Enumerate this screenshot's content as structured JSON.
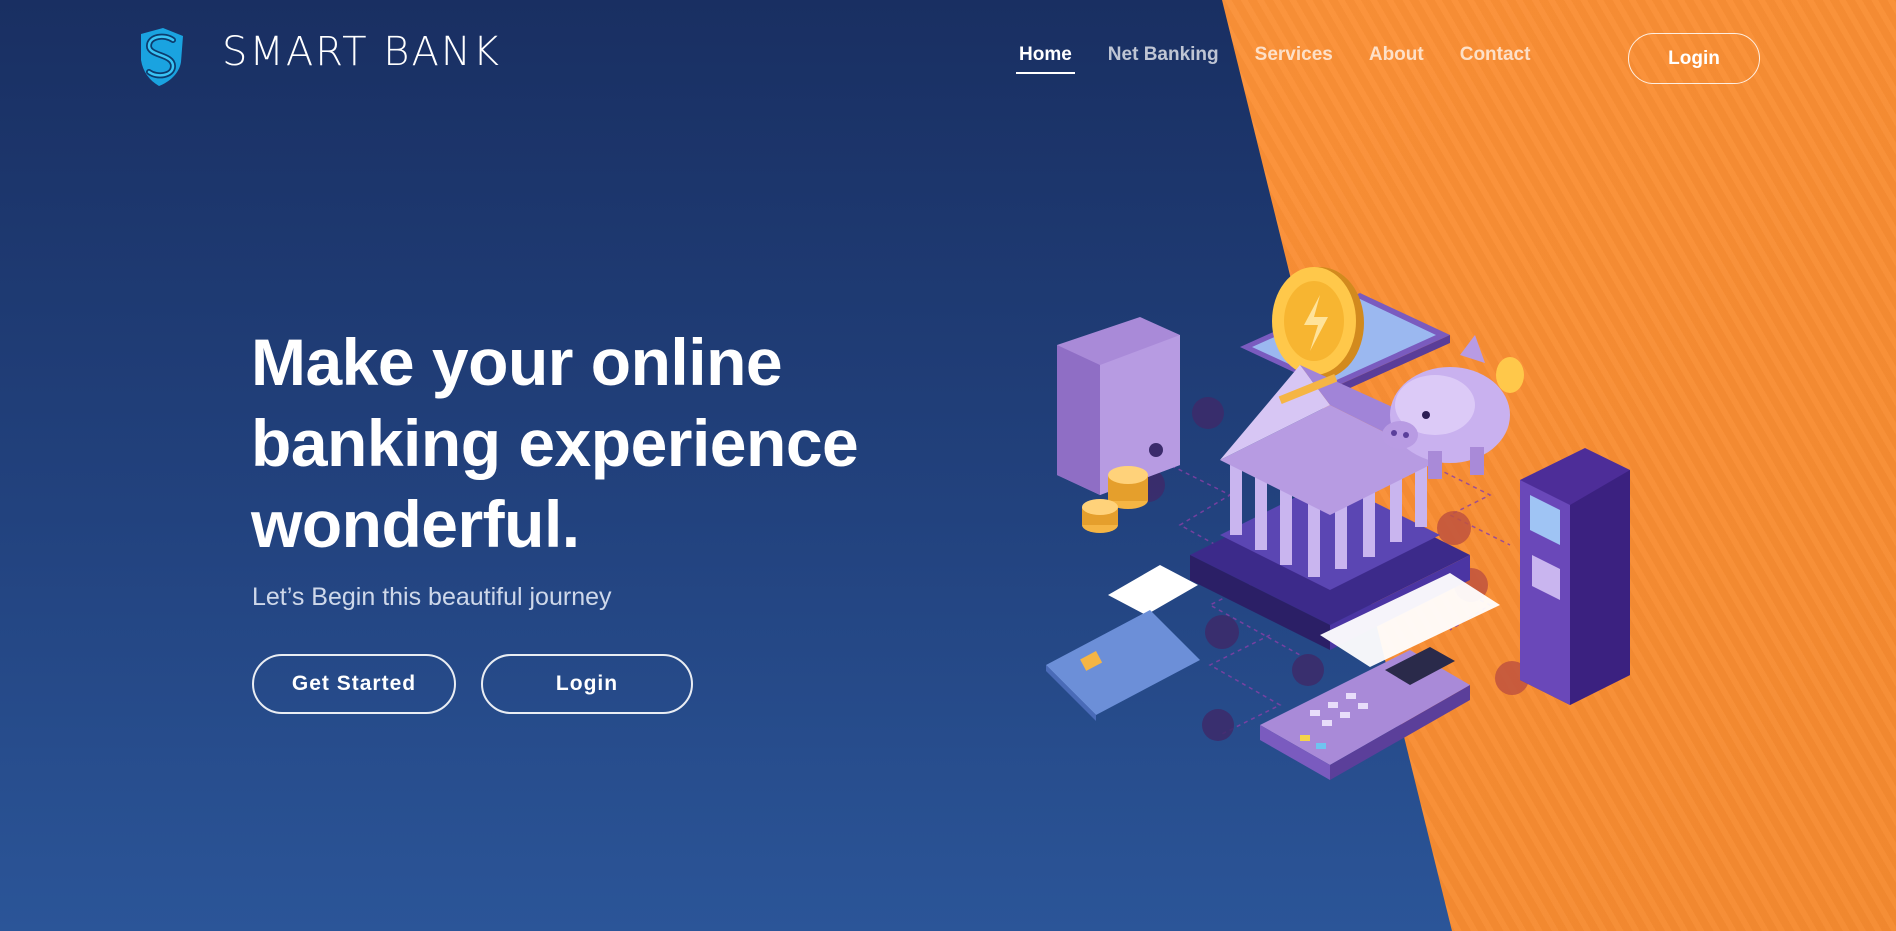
{
  "brand": {
    "name": "SMART BANK",
    "logo_icon": "shield-s-icon"
  },
  "nav": {
    "items": [
      {
        "label": "Home",
        "active": true
      },
      {
        "label": "Net Banking",
        "active": false
      },
      {
        "label": "Services",
        "active": false
      },
      {
        "label": "About",
        "active": false
      },
      {
        "label": "Contact",
        "active": false
      }
    ],
    "login_label": "Login"
  },
  "hero": {
    "title_line1": "Make your online",
    "title_line2": "banking experience",
    "title_line3": "wonderful.",
    "subtitle": "Let’s Begin this beautiful journey",
    "get_started_label": "Get Started",
    "login_label": "Login"
  },
  "colors": {
    "navy": "#1e3a72",
    "orange": "#fb9036",
    "purple": "#a98ad8",
    "gold": "#f5b544"
  },
  "illustration": {
    "icons": [
      "wallet-icon",
      "coin-stack-icon",
      "bank-building-icon",
      "smartphone-icon",
      "gold-coin-icon",
      "piggy-bank-icon",
      "atm-icon",
      "credit-card-icon",
      "pos-terminal-icon"
    ]
  }
}
